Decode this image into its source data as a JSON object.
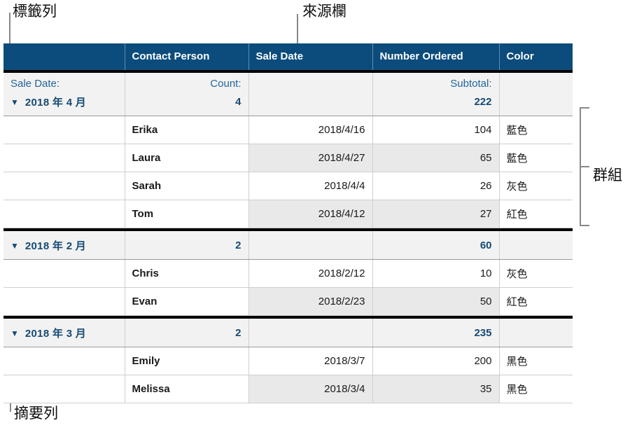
{
  "annotations": [
    {
      "id": "label-row",
      "text": "標籤列"
    },
    {
      "id": "source-column",
      "text": "來源欄"
    },
    {
      "id": "group",
      "text": "群組"
    },
    {
      "id": "summary-row",
      "text": "摘要列"
    }
  ],
  "table": {
    "columns": [
      "",
      "Contact Person",
      "Sale Date",
      "Number Ordered",
      "Color"
    ],
    "label_row": {
      "group_by_label": "Sale Date:",
      "count_label": "Count:",
      "sale_date_label": "",
      "subtotal_label": "Subtotal:",
      "color_label": ""
    },
    "groups": [
      {
        "title": "2018 年 4 月",
        "count": "4",
        "subtotal": "222",
        "rows": [
          {
            "contact": "Erika",
            "date": "2018/4/16",
            "number": "104",
            "color": "藍色"
          },
          {
            "contact": "Laura",
            "date": "2018/4/27",
            "number": "65",
            "color": "藍色"
          },
          {
            "contact": "Sarah",
            "date": "2018/4/4",
            "number": "26",
            "color": "灰色"
          },
          {
            "contact": "Tom",
            "date": "2018/4/12",
            "number": "27",
            "color": "紅色"
          }
        ]
      },
      {
        "title": "2018 年 2 月",
        "count": "2",
        "subtotal": "60",
        "rows": [
          {
            "contact": "Chris",
            "date": "2018/2/12",
            "number": "10",
            "color": "灰色"
          },
          {
            "contact": "Evan",
            "date": "2018/2/23",
            "number": "50",
            "color": "紅色"
          }
        ]
      },
      {
        "title": "2018 年 3 月",
        "count": "2",
        "subtotal": "235",
        "rows": [
          {
            "contact": "Emily",
            "date": "2018/3/7",
            "number": "200",
            "color": "黑色"
          },
          {
            "contact": "Melissa",
            "date": "2018/3/4",
            "number": "35",
            "color": "黑色"
          }
        ]
      }
    ]
  },
  "icons": {
    "disclosure_open": "▼"
  },
  "colors": {
    "header_blue": "#0c4c7c",
    "summary_text_blue": "#154a73",
    "name_blue": "#155283",
    "label_blue": "#22659b",
    "summary_fill": "#f2f2f2",
    "alt_row_fill": "#e9e9e9",
    "rule_black": "#000000",
    "leader_gray": "#888888"
  }
}
